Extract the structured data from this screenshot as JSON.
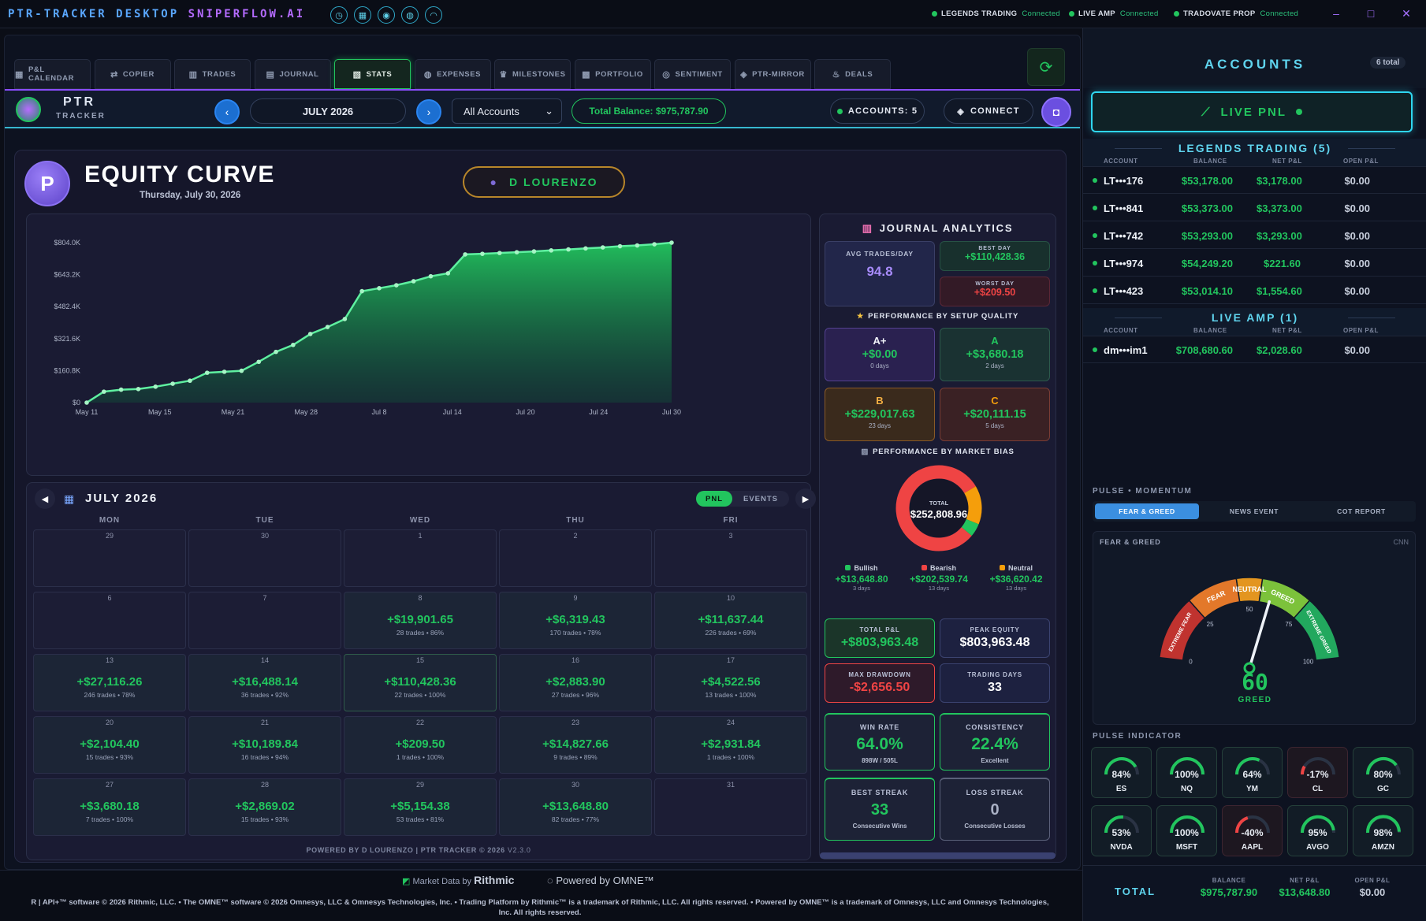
{
  "titlebar": {
    "title": "PTR-TRACKER DESKTOP",
    "brand": "SNIPERFLOW.AI",
    "connections": [
      {
        "name": "LEGENDS TRADING",
        "status": "Connected"
      },
      {
        "name": "LIVE AMP",
        "status": "Connected"
      },
      {
        "name": "TRADOVATE PROP",
        "status": "Connected"
      }
    ],
    "window": {
      "min": "–",
      "max": "□",
      "close": "✕"
    }
  },
  "tabs": [
    {
      "label": "P&L CALENDAR",
      "icon": "calendar-icon"
    },
    {
      "label": "COPIER",
      "icon": "copy-icon"
    },
    {
      "label": "TRADES",
      "icon": "bar-chart-icon"
    },
    {
      "label": "JOURNAL",
      "icon": "book-icon"
    },
    {
      "label": "STATS",
      "icon": "stats-icon"
    },
    {
      "label": "EXPENSES",
      "icon": "money-bag-icon"
    },
    {
      "label": "MILESTONES",
      "icon": "trophy-icon"
    },
    {
      "label": "PORTFOLIO",
      "icon": "portfolio-icon"
    },
    {
      "label": "SENTIMENT",
      "icon": "target-icon"
    },
    {
      "label": "PTR-MIRROR",
      "icon": "mirror-icon"
    },
    {
      "label": "DEALS",
      "icon": "fire-icon"
    }
  ],
  "header": {
    "logo_top": "PTR",
    "logo_bottom": "TRACKER",
    "month": "JULY 2026",
    "account_select": "All Accounts",
    "total_balance": "Total Balance: $975,787.90",
    "accounts_count": "ACCOUNTS: 5",
    "connect": "CONNECT"
  },
  "equity": {
    "avatar": "P",
    "title": "EQUITY CURVE",
    "date": "Thursday, July 30, 2026",
    "trader": "D LOURENZO"
  },
  "chart_data": {
    "type": "area",
    "title": "",
    "y_ticks": [
      "$804.0K",
      "$643.2K",
      "$482.4K",
      "$321.6K",
      "$160.8K",
      "$0"
    ],
    "x_ticks": [
      "May 11",
      "May 15",
      "May 21",
      "May 28",
      "Jul 8",
      "Jul 14",
      "Jul 20",
      "Jul 24",
      "Jul 30"
    ],
    "ylim": [
      0,
      804000
    ],
    "values": [
      0,
      55000,
      65000,
      68000,
      80000,
      95000,
      110000,
      150000,
      155000,
      160000,
      205000,
      255000,
      290000,
      345000,
      380000,
      420000,
      560000,
      575000,
      590000,
      610000,
      635000,
      650000,
      745000,
      748000,
      752000,
      756000,
      760000,
      765000,
      770000,
      775000,
      780000,
      786000,
      790000,
      796000,
      803963
    ]
  },
  "calendar": {
    "title": "JULY 2026",
    "toggle": [
      "PNL",
      "EVENTS"
    ],
    "days": [
      "MON",
      "TUE",
      "WED",
      "THU",
      "FRI"
    ],
    "cells": [
      {
        "d": "29",
        "v": "",
        "t": ""
      },
      {
        "d": "30",
        "v": "",
        "t": ""
      },
      {
        "d": "1",
        "v": "",
        "t": ""
      },
      {
        "d": "2",
        "v": "",
        "t": ""
      },
      {
        "d": "3",
        "v": "",
        "t": ""
      },
      {
        "d": "6",
        "v": "",
        "t": ""
      },
      {
        "d": "7",
        "v": "",
        "t": ""
      },
      {
        "d": "8",
        "v": "+$19,901.65",
        "t": "28 trades • 86%"
      },
      {
        "d": "9",
        "v": "+$6,319.43",
        "t": "170 trades • 78%"
      },
      {
        "d": "10",
        "v": "+$11,637.44",
        "t": "226 trades • 69%"
      },
      {
        "d": "13",
        "v": "+$27,116.26",
        "t": "246 trades • 78%"
      },
      {
        "d": "14",
        "v": "+$16,488.14",
        "t": "36 trades • 92%"
      },
      {
        "d": "15",
        "v": "+$110,428.36",
        "t": "22 trades • 100%"
      },
      {
        "d": "16",
        "v": "+$2,883.90",
        "t": "27 trades • 96%"
      },
      {
        "d": "17",
        "v": "+$4,522.56",
        "t": "13 trades • 100%"
      },
      {
        "d": "20",
        "v": "+$2,104.40",
        "t": "15 trades • 93%"
      },
      {
        "d": "21",
        "v": "+$10,189.84",
        "t": "16 trades • 94%"
      },
      {
        "d": "22",
        "v": "+$209.50",
        "t": "1 trades • 100%"
      },
      {
        "d": "23",
        "v": "+$14,827.66",
        "t": "9 trades • 89%"
      },
      {
        "d": "24",
        "v": "+$2,931.84",
        "t": "1 trades • 100%"
      },
      {
        "d": "27",
        "v": "+$3,680.18",
        "t": "7 trades • 100%"
      },
      {
        "d": "28",
        "v": "+$2,869.02",
        "t": "15 trades • 93%"
      },
      {
        "d": "29",
        "v": "+$5,154.38",
        "t": "53 trades • 81%"
      },
      {
        "d": "30",
        "v": "+$13,648.80",
        "t": "82 trades • 77%"
      },
      {
        "d": "31",
        "v": "",
        "t": ""
      }
    ],
    "footer": "POWERED BY D LOURENZO | PTR TRACKER © 2026",
    "version": "V2.3.0"
  },
  "journal": {
    "title": "JOURNAL ANALYTICS",
    "avg_label": "AVG TRADES/DAY",
    "avg": "94.8",
    "best_label": "BEST DAY",
    "best": "+$110,428.36",
    "worst_label": "WORST DAY",
    "worst": "+$209.50",
    "setup_title": "PERFORMANCE BY SETUP QUALITY",
    "setups": [
      {
        "g": "A+",
        "v": "+$0.00",
        "d": "0 days"
      },
      {
        "g": "A",
        "v": "+$3,680.18",
        "d": "2 days"
      },
      {
        "g": "B",
        "v": "+$229,017.63",
        "d": "23 days"
      },
      {
        "g": "C",
        "v": "+$20,111.15",
        "d": "5 days"
      }
    ],
    "bias_title": "PERFORMANCE BY MARKET BIAS",
    "donut_label": "TOTAL",
    "donut_total": "$252,808.96",
    "bias": [
      {
        "name": "Bullish",
        "v": "+$13,648.80",
        "d": "3 days",
        "color": "#22c55e"
      },
      {
        "name": "Bearish",
        "v": "+$202,539.74",
        "d": "13 days",
        "color": "#ef4444"
      },
      {
        "name": "Neutral",
        "v": "+$36,620.42",
        "d": "13 days",
        "color": "#f59e0b"
      }
    ],
    "total_pnl_label": "TOTAL P&L",
    "total_pnl": "+$803,963.48",
    "peak_label": "PEAK EQUITY",
    "peak": "$803,963.48",
    "dd_label": "MAX DRAWDOWN",
    "dd": "-$2,656.50",
    "days_label": "TRADING DAYS",
    "days": "33",
    "win_label": "WIN RATE",
    "win": "64.0%",
    "win_sub": "898W / 505L",
    "cons_label": "CONSISTENCY",
    "cons": "22.4%",
    "cons_sub": "Excellent",
    "best_streak_label": "BEST STREAK",
    "best_streak": "33",
    "best_streak_sub": "Consecutive Wins",
    "loss_streak_label": "LOSS STREAK",
    "loss_streak": "0",
    "loss_streak_sub": "Consecutive Losses"
  },
  "accounts": {
    "title": "ACCOUNTS",
    "total": "6 total",
    "live_pnl": "LIVE PNL",
    "groups": [
      {
        "name": "LEGENDS TRADING (5)",
        "rows": [
          {
            "n": "LT•••176",
            "b": "$53,178.00",
            "p": "$3,178.00",
            "o": "$0.00"
          },
          {
            "n": "LT•••841",
            "b": "$53,373.00",
            "p": "$3,373.00",
            "o": "$0.00"
          },
          {
            "n": "LT•••742",
            "b": "$53,293.00",
            "p": "$3,293.00",
            "o": "$0.00"
          },
          {
            "n": "LT•••974",
            "b": "$54,249.20",
            "p": "$221.60",
            "o": "$0.00"
          },
          {
            "n": "LT•••423",
            "b": "$53,014.10",
            "p": "$1,554.60",
            "o": "$0.00"
          }
        ]
      },
      {
        "name": "LIVE AMP (1)",
        "rows": [
          {
            "n": "dm•••im1",
            "b": "$708,680.60",
            "p": "$2,028.60",
            "o": "$0.00"
          }
        ]
      }
    ],
    "cols": [
      "ACCOUNT",
      "BALANCE",
      "NET P&L",
      "OPEN P&L"
    ],
    "total_label": "TOTAL",
    "total_bal": "$975,787.90",
    "total_pnl": "$13,648.80",
    "total_open": "$0.00"
  },
  "pulse": {
    "title": "PULSE • MOMENTUM",
    "tabs": [
      "FEAR & GREED",
      "NEWS EVENT",
      "COT REPORT"
    ],
    "fg_label": "FEAR & GREED",
    "source": "CNN",
    "value": 60,
    "rating": "GREED",
    "zones": [
      "EXTREME FEAR",
      "FEAR",
      "NEUTRAL",
      "GREED",
      "EXTREME GREED"
    ],
    "ticks": [
      "0",
      "25",
      "50",
      "75",
      "100"
    ],
    "indicator_title": "PULSE INDICATOR",
    "indicators": [
      {
        "s": "ES",
        "p": "84%",
        "f": 0.84
      },
      {
        "s": "NQ",
        "p": "100%",
        "f": 1.0
      },
      {
        "s": "YM",
        "p": "64%",
        "f": 0.64
      },
      {
        "s": "CL",
        "p": "-17%",
        "f": -0.17
      },
      {
        "s": "GC",
        "p": "80%",
        "f": 0.8
      },
      {
        "s": "NVDA",
        "p": "53%",
        "f": 0.53
      },
      {
        "s": "MSFT",
        "p": "100%",
        "f": 1.0
      },
      {
        "s": "AAPL",
        "p": "-40%",
        "f": -0.4
      },
      {
        "s": "AVGO",
        "p": "95%",
        "f": 0.95
      },
      {
        "s": "AMZN",
        "p": "98%",
        "f": 0.98
      }
    ]
  },
  "footer": {
    "market_data": "Market Data by",
    "rithmic": "Rithmic",
    "omne": "Powered by OMNE™",
    "legal": "R | API+™ software © 2026 Rithmic, LLC. • The OMNE™ software © 2026 Omnesys, LLC & Omnesys Technologies, Inc. • Trading Platform by Rithmic™ is a trademark of Rithmic, LLC. All rights reserved. • Powered by OMNE™ is a trademark of Omnesys, LLC and Omnesys Technologies, Inc. All rights reserved."
  }
}
